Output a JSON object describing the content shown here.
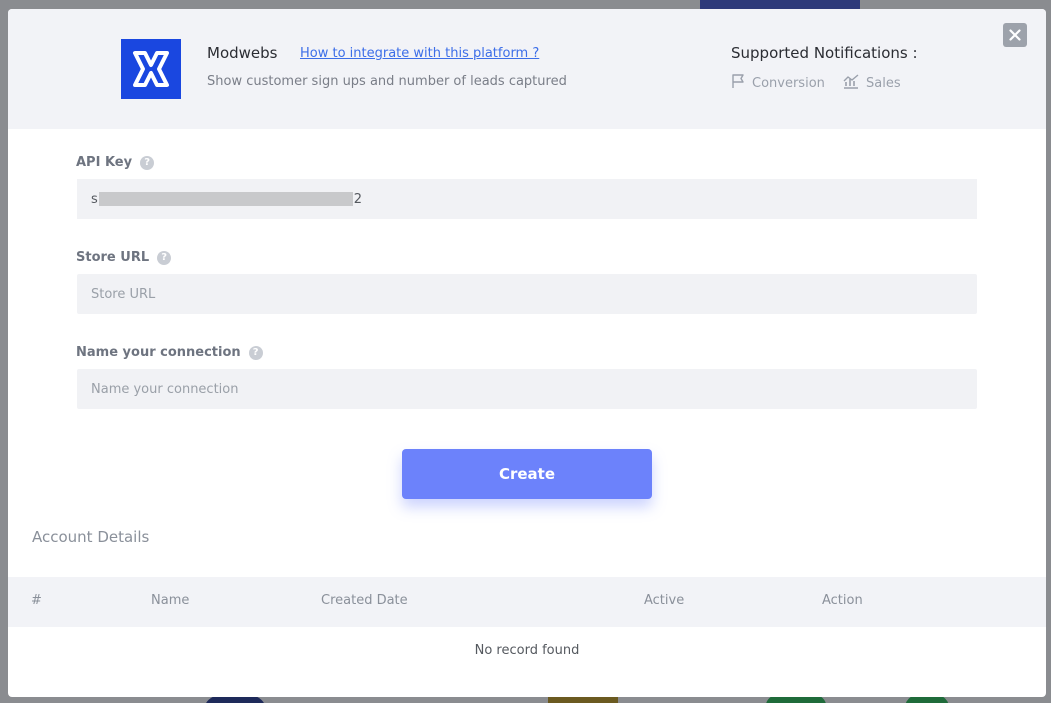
{
  "header": {
    "platform_name": "Modwebs",
    "integrate_link": "How to integrate with this platform ?",
    "description": "Show customer sign ups and number of leads captured",
    "notifications_title": "Supported Notifications :",
    "notifications": [
      {
        "label": "Conversion",
        "icon": "flag-icon"
      },
      {
        "label": "Sales",
        "icon": "sales-chart-icon"
      }
    ],
    "close_icon": "close-icon"
  },
  "form": {
    "api_key": {
      "label": "API Key",
      "value_start": "s",
      "value_end": "2"
    },
    "store_url": {
      "label": "Store URL",
      "placeholder": "Store URL",
      "value": ""
    },
    "connection_name": {
      "label": "Name your connection",
      "placeholder": "Name your connection",
      "value": ""
    },
    "help_glyph": "?",
    "create_label": "Create"
  },
  "account": {
    "title": "Account Details",
    "columns": [
      "#",
      "Name",
      "Created Date",
      "Active",
      "Action"
    ],
    "empty_message": "No record found"
  },
  "colors": {
    "accent": "#6c82fb",
    "logo_bg": "#1a47e0",
    "link": "#3c6ee8"
  }
}
